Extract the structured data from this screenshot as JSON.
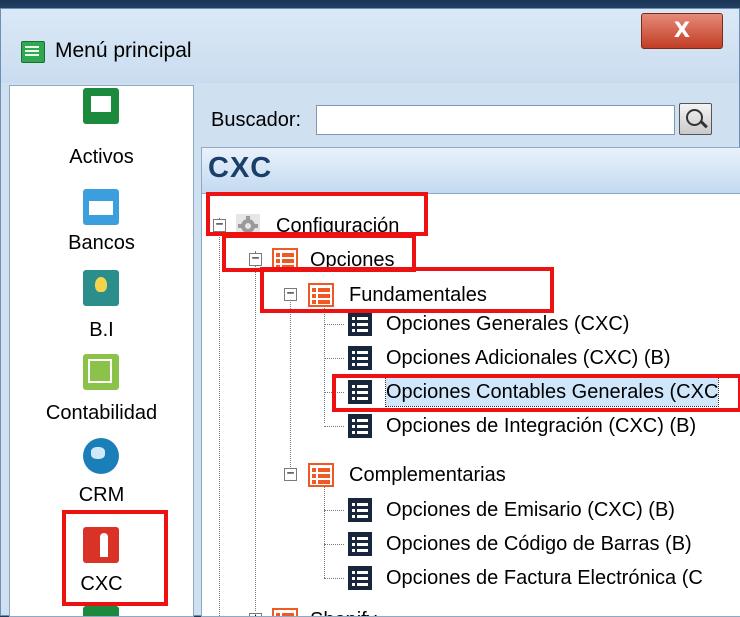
{
  "window": {
    "title": "Menú principal",
    "close_label": "X"
  },
  "sidebar": {
    "items": [
      {
        "label": "Activos",
        "icon": "cash-register-icon"
      },
      {
        "label": "Bancos",
        "icon": "briefcase-icon"
      },
      {
        "label": "B.I",
        "icon": "lightbulb-icon"
      },
      {
        "label": "Contabilidad",
        "icon": "chart-trend-icon"
      },
      {
        "label": "CRM",
        "icon": "globe-icon"
      },
      {
        "label": "CXC",
        "icon": "person-money-icon"
      }
    ]
  },
  "search": {
    "label": "Buscador:",
    "value": "",
    "placeholder": ""
  },
  "module": {
    "title": "CXC"
  },
  "tree": {
    "configuracion": "Configuración",
    "opciones": "Opciones",
    "fundamentales": "Fundamentales",
    "fundamentales_items": [
      "Opciones Generales (CXC)",
      "Opciones Adicionales (CXC) (B)",
      "Opciones Contables Generales (CXC",
      "Opciones de Integración (CXC) (B)"
    ],
    "complementarias": "Complementarias",
    "complementarias_items": [
      "Opciones de Emisario (CXC) (B)",
      "Opciones de Código de Barras (B)",
      "Opciones de Factura Electrónica (C"
    ],
    "shopify": "Shopify"
  },
  "colors": {
    "highlight_box": "#ee1111",
    "module_title": "#1a3f6a",
    "orange_icon": "#ef5a24",
    "dark_icon": "#17263a"
  }
}
